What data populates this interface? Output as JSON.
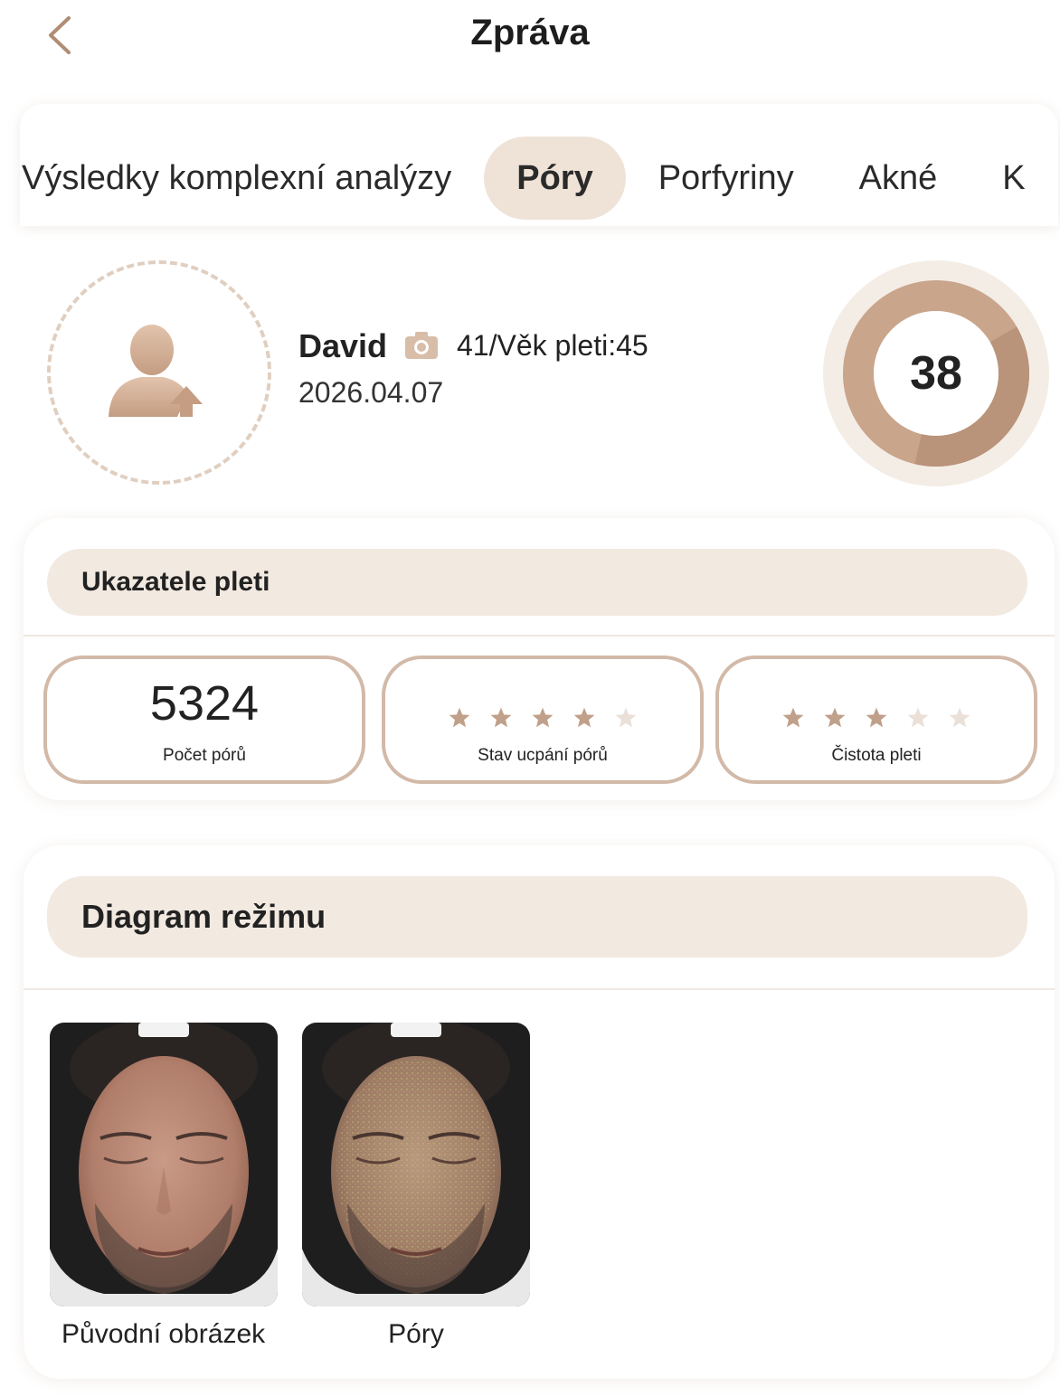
{
  "header": {
    "title": "Zpráva"
  },
  "tabs": [
    {
      "label": "Výsledky komplexní analýzy",
      "active": false
    },
    {
      "label": "Póry",
      "active": true
    },
    {
      "label": "Porfyriny",
      "active": false
    },
    {
      "label": "Akné",
      "active": false
    },
    {
      "label": "K",
      "active": false
    }
  ],
  "profile": {
    "name": "David",
    "age_text": "41/Věk pleti:45",
    "date": "2026.04.07",
    "score": "38"
  },
  "indicators": {
    "title": "Ukazatele pleti",
    "pore_count": {
      "value": "5324",
      "label": "Počet pórů"
    },
    "pore_clog": {
      "label": "Stav ucpání pórů",
      "stars_filled": 4,
      "stars_total": 5
    },
    "cleanliness": {
      "label": "Čistota pleti",
      "stars_filled": 3,
      "stars_total": 5
    }
  },
  "diagram": {
    "title": "Diagram režimu",
    "images": [
      {
        "caption": "Původní obrázek"
      },
      {
        "caption": "Póry"
      }
    ]
  },
  "colors": {
    "accent": "#c9a58c",
    "pill_bg": "#f2e9e1",
    "star_filled": "#c0a08a",
    "star_empty": "#ebe0d8"
  }
}
